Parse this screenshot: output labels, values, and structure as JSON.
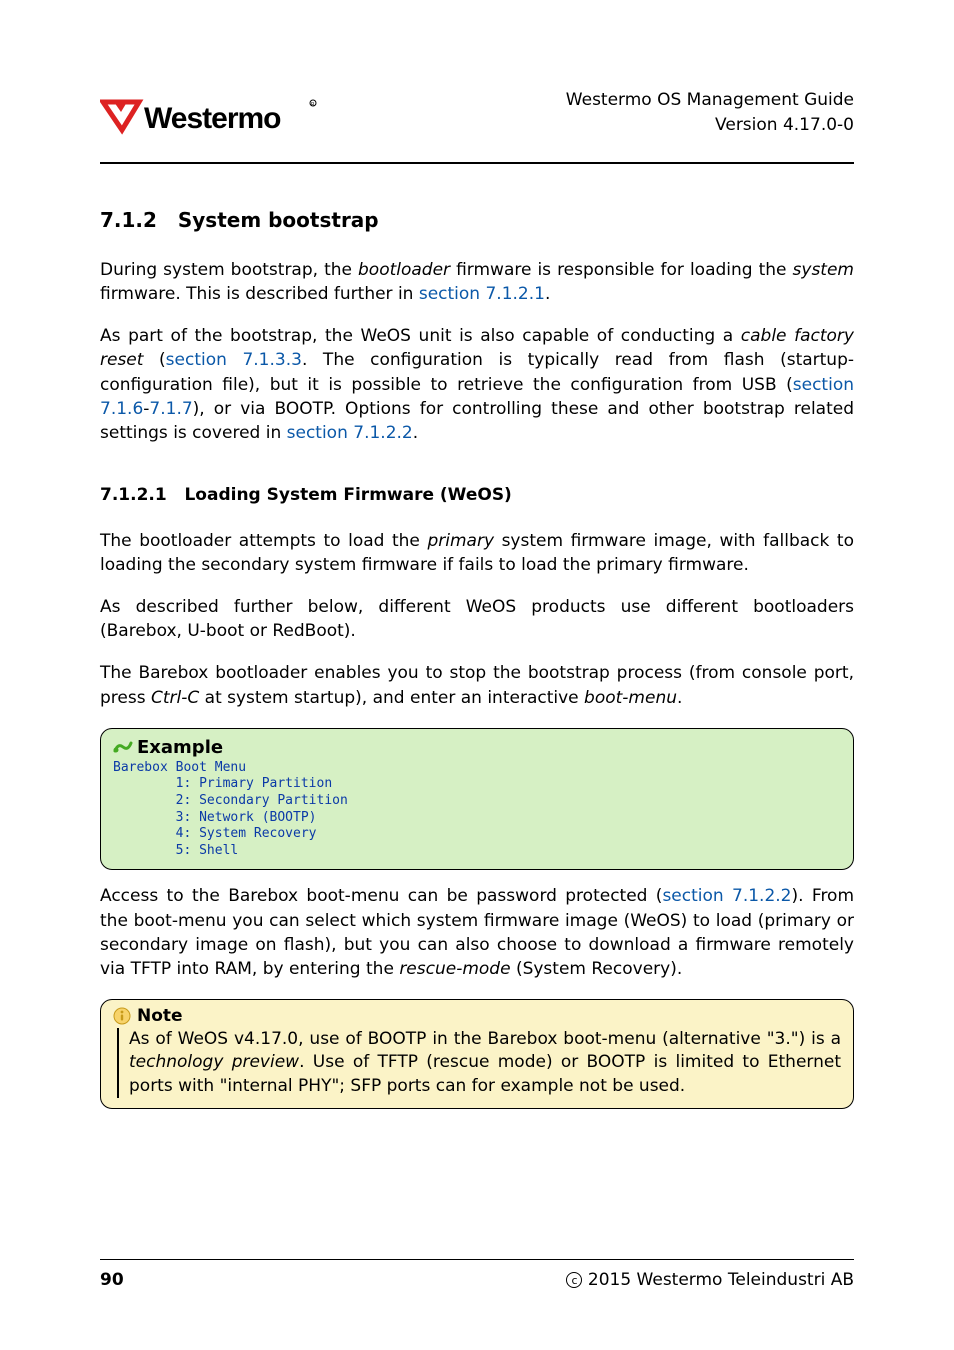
{
  "header": {
    "doc_title": "Westermo OS Management Guide",
    "version": "Version 4.17.0-0",
    "logo_text": "Westermo"
  },
  "s712": {
    "number": "7.1.2",
    "title": "System bootstrap",
    "p1a": "During system bootstrap, the ",
    "p1b": "bootloader",
    "p1c": " firmware is responsible for loading the ",
    "p1d": "system",
    "p1e": " firmware. This is described further in ",
    "p1link": "section 7.1.2.1",
    "p1f": ".",
    "p2a": "As part of the bootstrap, the WeOS unit is also capable of conducting a ",
    "p2b": "cable factory reset",
    "p2c": " (",
    "p2link1": "section 7.1.3.3",
    "p2d": ". The configuration is typically read from flash (startup-configuration file), but it is possible to retrieve the configuration from USB (",
    "p2link2": "section 7.1.6",
    "p2e": "-",
    "p2link3": "7.1.7",
    "p2f": "), or via BOOTP. Options for controlling these and other bootstrap related settings is covered in ",
    "p2link4": "section 7.1.2.2",
    "p2g": "."
  },
  "s7121": {
    "number": "7.1.2.1",
    "title": "Loading System Firmware (WeOS)",
    "p1a": "The bootloader attempts to load the ",
    "p1b": "primary",
    "p1c": " system firmware image, with fallback to loading the secondary system firmware if fails to load the primary firmware.",
    "p2": "As described further below, different WeOS products use different bootloaders (Barebox, U-boot or RedBoot).",
    "p3a": "The Barebox bootloader enables you to stop the bootstrap process (from console port, press ",
    "p3b": "Ctrl-C",
    "p3c": " at system startup), and enter an interactive ",
    "p3d": "boot-menu",
    "p3e": "."
  },
  "example": {
    "label": "Example",
    "code": "Barebox Boot Menu\n        1: Primary Partition\n        2: Secondary Partition\n        3: Network (BOOTP)\n        4: System Recovery\n        5: Shell"
  },
  "after_example": {
    "p1a": "Access to the Barebox boot-menu can be password protected (",
    "p1link": "section 7.1.2.2",
    "p1b": "). From the boot-menu you can select which system firmware image (WeOS) to load (primary or secondary image on flash), but you can also choose to download a firmware remotely via TFTP into RAM, by entering the ",
    "p1c": "rescue-mode",
    "p1d": " (System Recovery)."
  },
  "note": {
    "label": "Note",
    "a": "As of WeOS v4.17.0, use of BOOTP in the Barebox boot-menu (alternative \"3.\")  is a ",
    "b": "technology preview",
    "c": ".  Use of TFTP (rescue mode) or BOOTP is limited to Ethernet ports with \"internal PHY\"; SFP ports can for example not be used."
  },
  "footer": {
    "page": "90",
    "copyright": "2015 Westermo Teleindustri AB"
  }
}
